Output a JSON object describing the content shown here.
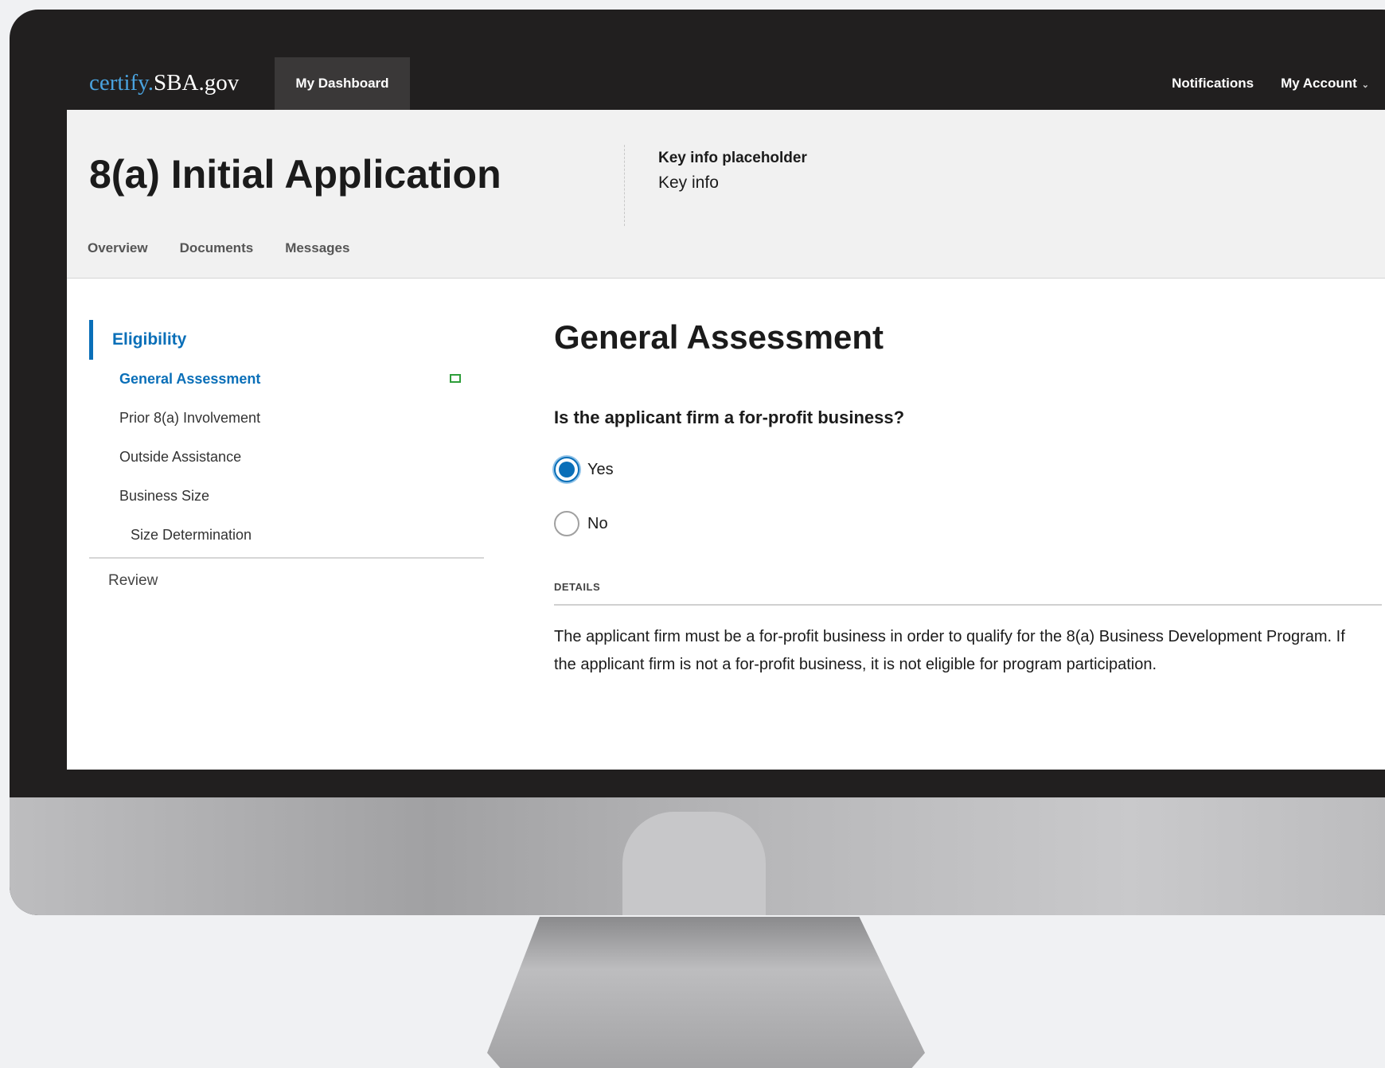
{
  "nav": {
    "brand_part1": "certify.",
    "brand_part2": "SBA.gov",
    "dashboard_tab": "My Dashboard",
    "notifications": "Notifications",
    "account": "My Account"
  },
  "header": {
    "title": "8(a) Initial Application",
    "key_info_label": "Key info placeholder",
    "key_info_value": "Key info",
    "tabs": [
      "Overview",
      "Documents",
      "Messages"
    ]
  },
  "sidebar": {
    "section": "Eligibility",
    "items": [
      {
        "label": "General Assessment",
        "active": true,
        "complete": true
      },
      {
        "label": "Prior 8(a) Involvement"
      },
      {
        "label": "Outside Assistance"
      },
      {
        "label": "Business Size"
      },
      {
        "label": "Size Determination",
        "indent": true
      }
    ],
    "review": "Review"
  },
  "main": {
    "title": "General Assessment",
    "question": "Is the applicant firm a for-profit business?",
    "options": [
      {
        "label": "Yes",
        "selected": true
      },
      {
        "label": "No",
        "selected": false
      }
    ],
    "details_label": "DETAILS",
    "details_text": "The applicant firm must be a for-profit business in order to qualify for the 8(a) Business Development Program. If the applicant firm is not a for-profit business, it is not eligible for program participation."
  },
  "colors": {
    "accent": "#0a6fb8",
    "topbar": "#211f1f",
    "complete": "#2e9e3a"
  }
}
